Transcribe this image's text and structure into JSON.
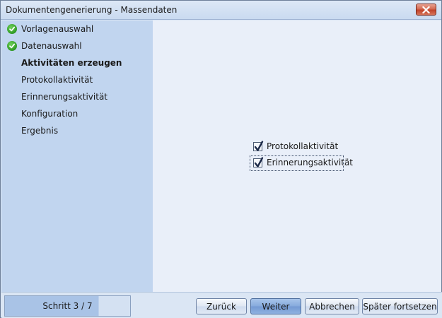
{
  "window": {
    "title": "Dokumentengenerierung - Massendaten"
  },
  "sidebar": {
    "steps": [
      {
        "label": "Vorlagenauswahl",
        "done": true
      },
      {
        "label": "Datenauswahl",
        "done": true
      },
      {
        "label": "Aktivitäten erzeugen",
        "done": false,
        "active": true
      },
      {
        "label": "Protokollaktivität",
        "done": false
      },
      {
        "label": "Erinnerungsaktivität",
        "done": false
      },
      {
        "label": "Konfiguration",
        "done": false
      },
      {
        "label": "Ergebnis",
        "done": false
      }
    ]
  },
  "main": {
    "checkboxes": [
      {
        "label": "Protokollaktivität",
        "checked": true
      },
      {
        "label": "Erinnerungsaktivität",
        "checked": true,
        "focused": true
      }
    ]
  },
  "footer": {
    "step_counter": "Schritt 3 / 7",
    "progress_fraction": 0.75,
    "buttons": {
      "back_label": "Zurück",
      "next_label": "Weiter",
      "cancel_label": "Abbrechen",
      "later_label": "Später fortsetzen"
    }
  },
  "colors": {
    "sidebar_bg": "#c1d5ef",
    "main_bg": "#e9eff9",
    "check_green": "#2f9a23",
    "primary_button": "#86aadd",
    "close_red": "#c2432a"
  },
  "icons": {
    "done_step": "check-circle-icon",
    "close": "close-icon",
    "checkbox": "checkmark-icon"
  }
}
